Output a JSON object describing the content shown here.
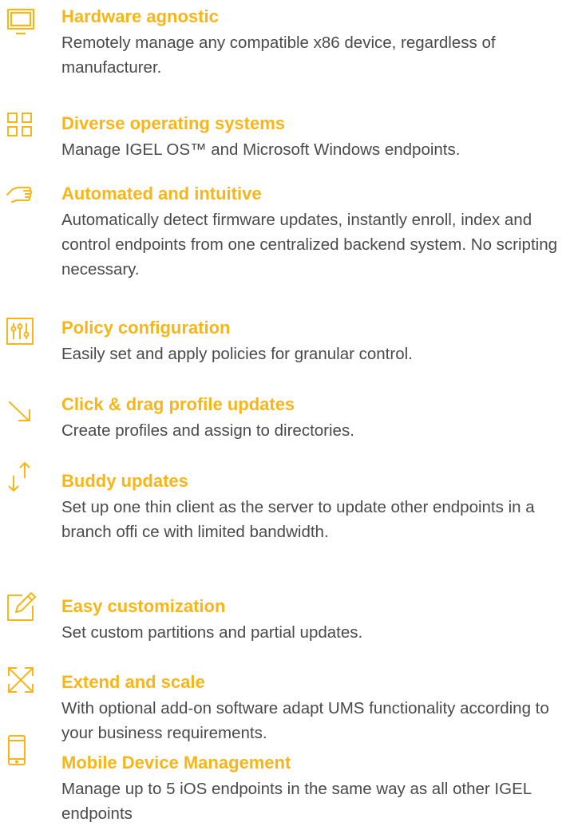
{
  "colors": {
    "accent": "#f7b518",
    "text": "#4a4a4a"
  },
  "features": [
    {
      "icon": "monitor-icon",
      "title": "Hardware agnostic",
      "description": "Remotely manage any compatible x86 device, regardless of manufacturer."
    },
    {
      "icon": "windows-grid-icon",
      "title": "Diverse operating systems",
      "description": "Manage IGEL OS™ and Microsoft Windows endpoints."
    },
    {
      "icon": "pointing-hand-icon",
      "title": "Automated and intuitive",
      "description": "Automatically detect firmware updates, instantly enroll, index and control endpoints from one centralized backend system. No scripting necessary."
    },
    {
      "icon": "sliders-icon",
      "title": "Policy configuration",
      "description": "Easily set and apply policies for granular control."
    },
    {
      "icon": "diagonal-arrow-icon",
      "title": "Click & drag profile updates",
      "description": "Create profiles and assign to directories."
    },
    {
      "icon": "up-down-arrows-icon",
      "title": "Buddy updates",
      "description": "Set up one thin client as the server to update other endpoints in a branch offi ce with limited bandwidth."
    },
    {
      "icon": "edit-pencil-icon",
      "title": "Easy customization",
      "description": "Set custom partitions and partial updates."
    },
    {
      "icon": "expand-arrows-icon",
      "title": "Extend and scale",
      "description": "With optional add-on software adapt UMS functionality according to your business requirements."
    },
    {
      "icon": "mobile-phone-icon",
      "title": "Mobile Device Management",
      "description": "Manage up to 5 iOS endpoints in the same way as all other IGEL endpoints"
    }
  ]
}
